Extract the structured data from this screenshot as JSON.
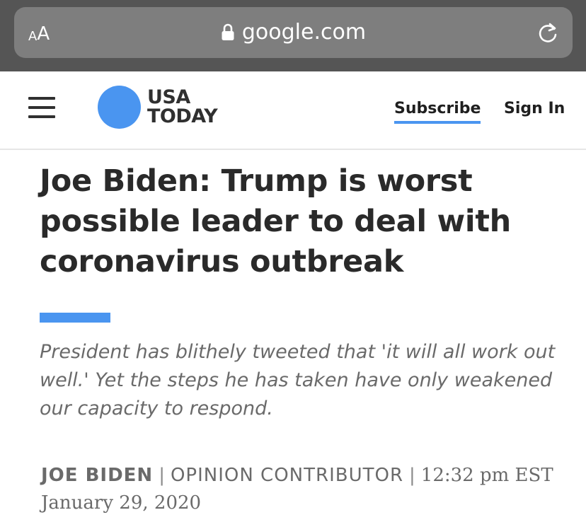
{
  "browser": {
    "text_size_small": "A",
    "text_size_large": "A",
    "url": "google.com",
    "icons": [
      "lock-icon",
      "reload-icon"
    ]
  },
  "header": {
    "logo_line1": "USA",
    "logo_line2": "TODAY",
    "subscribe_label": "Subscribe",
    "signin_label": "Sign In",
    "menu_icon": "hamburger-icon",
    "colors": {
      "brand_blue": "#4a95f0",
      "text": "#2a2a2a"
    }
  },
  "article": {
    "headline": "Joe Biden: Trump is worst possible leader to deal with coronavirus outbreak",
    "subhead": "President has blithely tweeted that 'it will all work out well.' Yet the steps he has taken have only weakened our capacity to respond.",
    "author": "JOE BIDEN",
    "separator": "|",
    "role": "OPINION CONTRIBUTOR",
    "timestamp": "12:32 pm EST January 29, 2020"
  }
}
